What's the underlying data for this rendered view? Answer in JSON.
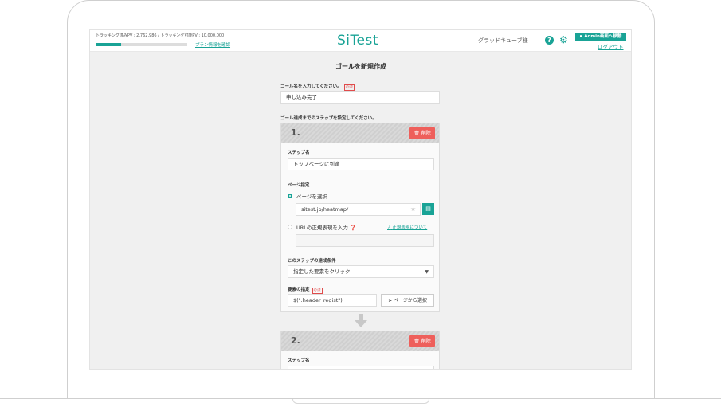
{
  "header": {
    "tracking_info": "トラッキング済みPV : 2,762,986 / トラッキング可能PV : 10,000,000",
    "plan_link": "プラン情報を確認",
    "tracking_progress": 0.28,
    "logo": "SiTest",
    "username": "グラッドキューブ様",
    "help_icon": "?",
    "settings_icon": "gear-icon",
    "admin_button": "Admin画面へ移動",
    "logout": "ログアウト"
  },
  "page": {
    "title": "ゴールを新規作成",
    "goal_name_label": "ゴール名を入力してください。",
    "required_badge": "必須",
    "goal_name_value": "申し込み完了",
    "steps_label": "ゴール達成までのステップを設定してください。"
  },
  "step1": {
    "number": "1.",
    "delete_label": "削除",
    "step_name_label": "ステップ名",
    "step_name_value": "トップページに到達",
    "page_spec_label": "ページ指定",
    "option_select_page": "ページを選択",
    "page_value": "sitest.jp/heatmap/",
    "option_regex": "URLの正規表現を入力",
    "regex_help_link": "正規表現について",
    "regex_value": "",
    "condition_label": "このステップの達成条件",
    "condition_value": "指定した要素をクリック",
    "element_label": "要素の指定",
    "element_value": "$(\".header_regist\")",
    "pick_from_page": "ページから選択"
  },
  "step2": {
    "number": "2.",
    "delete_label": "削除",
    "step_name_label": "ステップ名"
  },
  "colors": {
    "accent": "#19a396",
    "danger": "#ee5f5b",
    "background": "#f0f0f0"
  }
}
